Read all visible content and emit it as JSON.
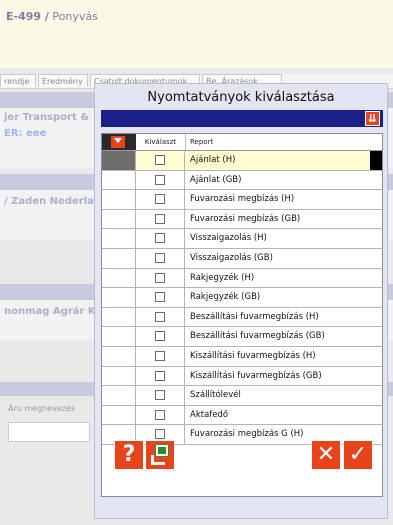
{
  "background": {
    "title_code": "E-499 /",
    "title_rest": " Ponyvás",
    "tabs": [
      "rendje",
      "Eredmény",
      "Csatolt dokumentumok",
      "Be. Árazások"
    ],
    "company1": "jer Transport &",
    "company1_sub": "ER: eee",
    "company2": "/ Zaden Nederla",
    "company3": "nonmag Agrár K",
    "field_label": "Áru megnevezés"
  },
  "dialog": {
    "title": "Nyomtatványok kiválasztása",
    "columns": {
      "select": "Kiválaszt",
      "report": "Report"
    },
    "rows": [
      {
        "label": "Ajánlat (H)",
        "checked": false,
        "selected": true
      },
      {
        "label": "Ajánlat (GB)",
        "checked": false,
        "selected": false
      },
      {
        "label": "Fuvarozási megbízás (H)",
        "checked": false,
        "selected": false
      },
      {
        "label": "Fuvarozási megbízás (GB)",
        "checked": false,
        "selected": false
      },
      {
        "label": "Visszaigazolás (H)",
        "checked": false,
        "selected": false
      },
      {
        "label": "Visszaigazolás (GB)",
        "checked": false,
        "selected": false
      },
      {
        "label": "Rakjegyzék (H)",
        "checked": false,
        "selected": false
      },
      {
        "label": "Rakjegyzék (GB)",
        "checked": false,
        "selected": false
      },
      {
        "label": "Beszállítási fuvarmegbízás (H)",
        "checked": false,
        "selected": false
      },
      {
        "label": "Beszállítási fuvarmegbízás (GB)",
        "checked": false,
        "selected": false
      },
      {
        "label": "Kiszállítási fuvarmegbízás (H)",
        "checked": false,
        "selected": false
      },
      {
        "label": "Kiszállítási fuvarmegbízás (GB)",
        "checked": false,
        "selected": false
      },
      {
        "label": "Szállítólevél",
        "checked": false,
        "selected": false
      },
      {
        "label": "Aktafedő",
        "checked": false,
        "selected": false
      },
      {
        "label": "Fuvarozási megbízás G (H)",
        "checked": false,
        "selected": false
      }
    ],
    "buttons": {
      "help": "?",
      "close": "✕",
      "ok": "✓"
    }
  },
  "colors": {
    "accent": "#e8441c",
    "bar": "#1b1f87",
    "selected_row": "#fffcd2"
  }
}
